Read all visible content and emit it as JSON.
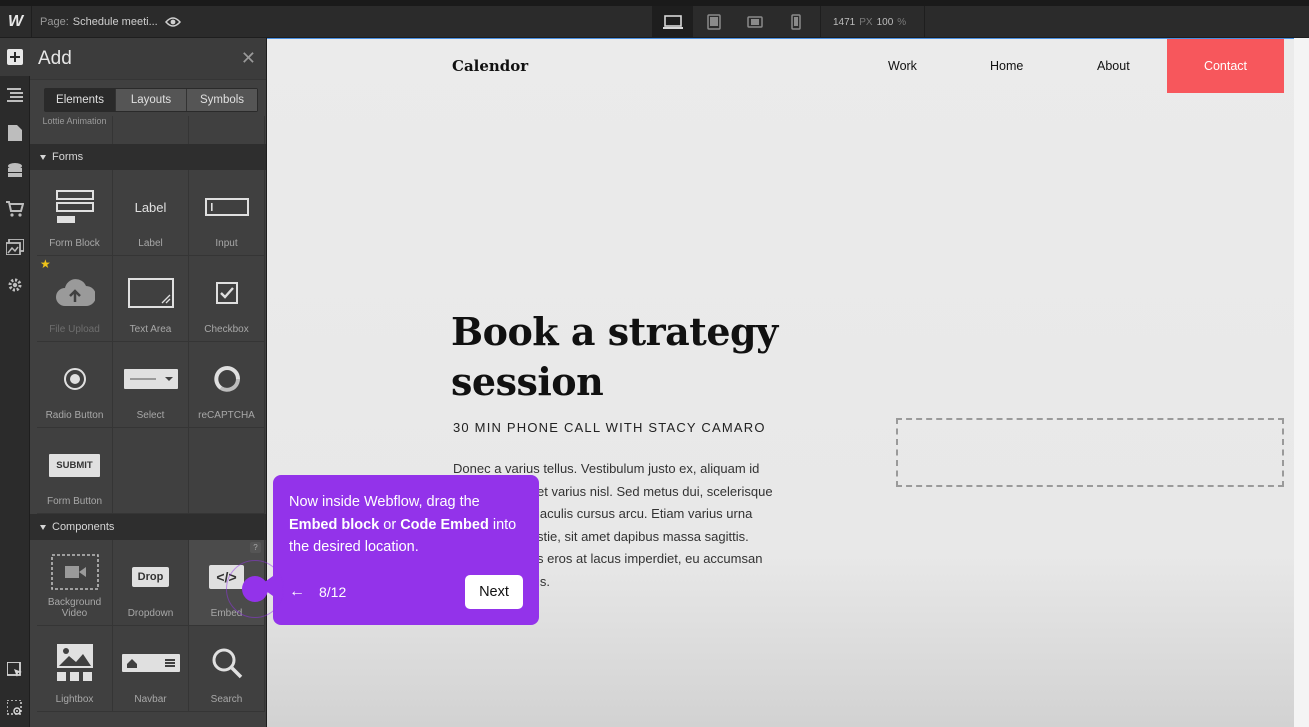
{
  "topbar": {
    "page_prefix": "Page:",
    "page_name": "Schedule meeti...",
    "width_value": "1471",
    "width_unit": "PX",
    "zoom_value": "100",
    "zoom_unit": "%"
  },
  "add_panel": {
    "title": "Add",
    "tabs": [
      "Elements",
      "Layouts",
      "Symbols"
    ],
    "truncated_row": [
      "Lottie Animation",
      "",
      ""
    ],
    "forms_heading": "Forms",
    "forms_items": [
      "Form Block",
      "Label",
      "Input",
      "File Upload",
      "Text Area",
      "Checkbox",
      "Radio Button",
      "Select",
      "reCAPTCHA",
      "Form Button"
    ],
    "label_icon_text": "Label",
    "submit_icon_text": "SUBMIT",
    "components_heading": "Components",
    "components_items": [
      "Background Video",
      "Dropdown",
      "Embed",
      "Lightbox",
      "Navbar",
      "Search"
    ],
    "dropdown_icon_text": "Drop",
    "embed_icon_text": "</>",
    "help_badge": "?"
  },
  "site": {
    "brand": "Calendor",
    "nav": [
      "Work",
      "Home",
      "About",
      "Contact"
    ],
    "hero_line1": "Book a strategy",
    "hero_line2": "session",
    "subheading": "30 MIN PHONE CALL WITH STACY CAMARO",
    "paragraph_lines": [
      "Donec a varius tellus. Vestibulum justo ex, aliquam id",
      "et varius nisl. Sed metus dui, scelerisque",
      "iaculis cursus arcu. Etiam varius urna",
      "stie, sit amet dapibus massa sagittis.",
      "s eros at lacus imperdiet, eu accumsan",
      "is."
    ]
  },
  "tooltip": {
    "text_a": "Now inside Webflow, drag the ",
    "bold_a": "Embed block",
    "text_b": " or ",
    "bold_b": "Code Embed",
    "text_c": " into the desired location.",
    "step": "8/12",
    "next_label": "Next"
  },
  "colors": {
    "accent_purple": "#9333ea",
    "contact_red": "#f7575c"
  }
}
